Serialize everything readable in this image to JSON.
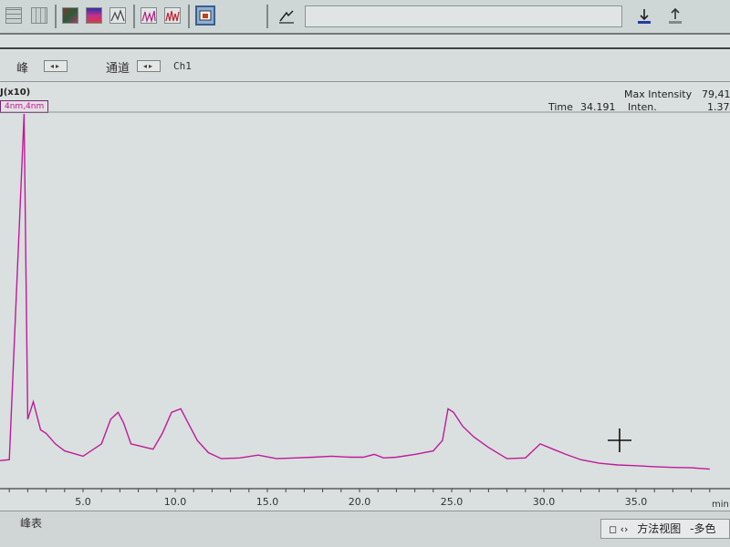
{
  "toolbar": {
    "icons": [
      "grid-icon",
      "table-icon",
      "color-map-icon",
      "gradient-icon",
      "chromatogram-icon",
      "peak-icon",
      "multi-peak-icon",
      "window-icon",
      "print-icon",
      "pointer-icon",
      "download-icon",
      "upload-icon"
    ],
    "command_value": ""
  },
  "selectors": {
    "peak_label": "峰",
    "channel_label": "通道",
    "channel_value": "Ch1"
  },
  "chart_header": {
    "y_unit": "J(x10)",
    "channel_tag": "4nm,4nm",
    "max_intensity_label": "Max Intensity",
    "max_intensity_value": "79,41",
    "time_label": "Time",
    "time_value": "34.191",
    "inten_label": "Inten.",
    "inten_value": "1.37"
  },
  "chart_data": {
    "type": "line",
    "title": "",
    "xlabel": "min",
    "ylabel": "J(x10)",
    "xlim": [
      0,
      39.5
    ],
    "x_ticks": [
      "5.0",
      "10.0",
      "15.0",
      "20.0",
      "25.0",
      "30.0",
      "35.0"
    ],
    "series": [
      {
        "color": "#c01a9a",
        "x": [
          0.0,
          1.0,
          1.8,
          2.0,
          2.3,
          2.5,
          2.7,
          3.0,
          3.5,
          4.0,
          5.0,
          6.0,
          6.5,
          6.9,
          7.2,
          7.6,
          8.0,
          8.4,
          8.8,
          9.3,
          9.8,
          10.3,
          10.7,
          11.2,
          11.8,
          12.5,
          13.5,
          14.5,
          15.5,
          16.5,
          17.5,
          18.5,
          19.5,
          20.2,
          20.8,
          21.3,
          22.0,
          23.0,
          24.0,
          24.5,
          24.8,
          25.1,
          25.6,
          26.2,
          27.0,
          28.0,
          29.0,
          29.8,
          30.5,
          31.2,
          32.0,
          33.0,
          34.0,
          35.0,
          36.0,
          37.0,
          38.0,
          39.0
        ],
        "y": [
          0.1,
          0.15,
          10.0,
          1.3,
          1.8,
          1.4,
          1.0,
          0.9,
          0.6,
          0.4,
          0.25,
          0.6,
          1.3,
          1.5,
          1.2,
          0.6,
          0.55,
          0.5,
          0.45,
          0.9,
          1.5,
          1.6,
          1.2,
          0.7,
          0.35,
          0.18,
          0.2,
          0.28,
          0.18,
          0.2,
          0.22,
          0.25,
          0.22,
          0.22,
          0.3,
          0.2,
          0.22,
          0.3,
          0.4,
          0.7,
          1.6,
          1.5,
          1.1,
          0.8,
          0.5,
          0.18,
          0.2,
          0.6,
          0.45,
          0.3,
          0.15,
          0.05,
          0.0,
          -0.02,
          -0.05,
          -0.07,
          -0.08,
          -0.12
        ]
      }
    ]
  },
  "bottom": {
    "peak_table_label": "峰表",
    "view_tab_label": "方法视图",
    "view_tab_extra": "-多色"
  }
}
